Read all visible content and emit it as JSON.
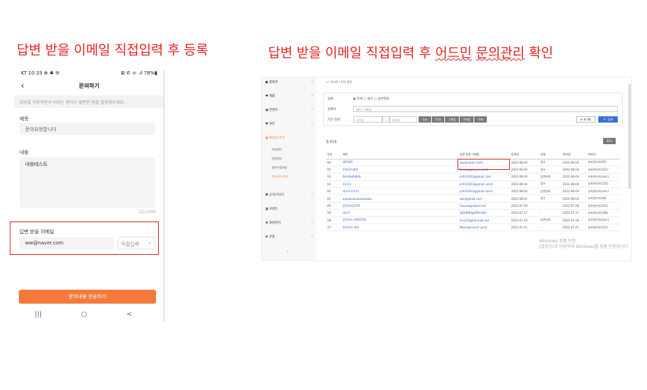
{
  "headings": {
    "left": "답변 받을 이메일 직접입력 후 등록",
    "right_prefix": "답변 받을 이메일 직접입력 후 ",
    "right_squig": "어드민",
    "right_mid": " ",
    "right_squig2": "문의관리",
    "right_suffix": " 확인"
  },
  "phone": {
    "status_left": "KT 10:33 ⊕ ♣ ✉",
    "status_right": "⊠ ✆ ᯤ .ıl 78%▮",
    "title": "문의하기",
    "notice": "답부를 이용하면서 바라는 점이나 불편한 점을 말씀해주세요.",
    "subject_label": "제목",
    "subject_value": "문의요청합니다",
    "content_label": "내용",
    "content_value": "내용테스트",
    "counter": "12/1000",
    "email_label": "답변 받을 이메일",
    "email_value": "ww@naver.com",
    "email_select": "직접입력",
    "submit_label": "문의내용 전송하기",
    "nav": [
      "|||",
      "○",
      "<"
    ]
  },
  "admin": {
    "sidebar": [
      {
        "label": "● 홈화면",
        "arrow": "›"
      },
      {
        "label": "♥ 제품",
        "arrow": "›"
      },
      {
        "label": "▣ 컨텐츠",
        "arrow": "›"
      },
      {
        "label": "♥ 쿠폰",
        "arrow": "›"
      },
      {
        "label": "▦ 회원글 관리",
        "arrow": "›"
      },
      {
        "label": "❷ 공지/가이드",
        "arrow": "›"
      },
      {
        "label": "▦ 브랜드",
        "arrow": "›"
      },
      {
        "label": "♣ 회원관리",
        "arrow": "›"
      },
      {
        "label": "✿ 운영",
        "arrow": "›"
      }
    ],
    "sidebar_sub": [
      "리뷰관리",
      "댓글관리",
      "정보수정요청",
      "문의하기 관리"
    ],
    "sidebar_collapse": "‹",
    "breadcrumb": "⌂ / 게시판 / 문의 관리",
    "filter": {
      "status_label": "상태",
      "status_value": "◉ 전체  ○ 접수  ○ 답변완료",
      "keyword_label": "검색어",
      "keyword_placeholder": "제목 / 이메일",
      "period_label": "기간 검색",
      "start_placeholder": "시작일",
      "end_placeholder": "종료일",
      "date_buttons": [
        "오늘",
        "15일",
        "1개월",
        "3개월",
        "전체"
      ],
      "reset_label": "⟳ 초기화",
      "search_label": "🔍 검색"
    },
    "total": "총 65개",
    "per_page": "20 ▾",
    "columns": [
      "번호",
      "제목",
      "답변 받을 이메일",
      "등록일",
      "상태",
      "처리일",
      "처리자"
    ],
    "rows": [
      [
        "66",
        "제목제목",
        "ww@naver.com1",
        "2022-08-04",
        "접수",
        "2022-08-04",
        "슈퍼관리자(95)"
      ],
      [
        "65",
        "문의하기제목",
        "5sssaa@naver.com1",
        "2022-08-04",
        "접수",
        "2022-08-04",
        "슈퍼관리자(101)"
      ],
      [
        "64",
        "6ehdbdbdjdh",
        "jmh10243@gmail.com",
        "2022-08-04",
        "답변완료",
        "2022-08-04",
        "슈퍼관리자(umc)"
      ],
      [
        "63",
        "11111",
        "jmh10243@gmail.com1",
        "2022-08-04",
        "접수",
        "2022-08-04",
        "슈퍼관리자(135)"
      ],
      [
        "62",
        "테스트11111",
        "jmh10243@gmail.com1",
        "2022-08-04",
        "답변완료",
        "2022-08-04",
        "슈퍼관리자(umc)"
      ],
      [
        "61",
        "aaaaaaaaaaaaaaaaa",
        "abc@gmail.com",
        "2022-08-01",
        "접수",
        "2022-08-02",
        "슈퍼관리자(48)"
      ],
      [
        "60",
        "문의하기0729",
        "5asaaa@daum.net",
        "2022-07-29",
        "-",
        "2022-07-29",
        "슈퍼관리자(101)"
      ],
      [
        "59",
        "테스트",
        "SJDHDRI@SISH.K81",
        "2022-07-27",
        "-",
        "2022-07-27",
        "슈퍼관리자(108)"
      ],
      [
        "58",
        "문의하기 제목0726",
        "5ss223@hanmail.net",
        "2022-07-26",
        "답변완료",
        "2022-07-26",
        "슈퍼관리자(umc)"
      ],
      [
        "57",
        "문의하기 제목",
        "Mama@naver.com1",
        "2022-07-21",
        "-",
        "2022-07-21",
        "슈퍼관리자(101)"
      ]
    ],
    "watermark": "Windows 정품 인증\n[설정]으로 이동하여 Windows를 정품 인증합니다."
  }
}
